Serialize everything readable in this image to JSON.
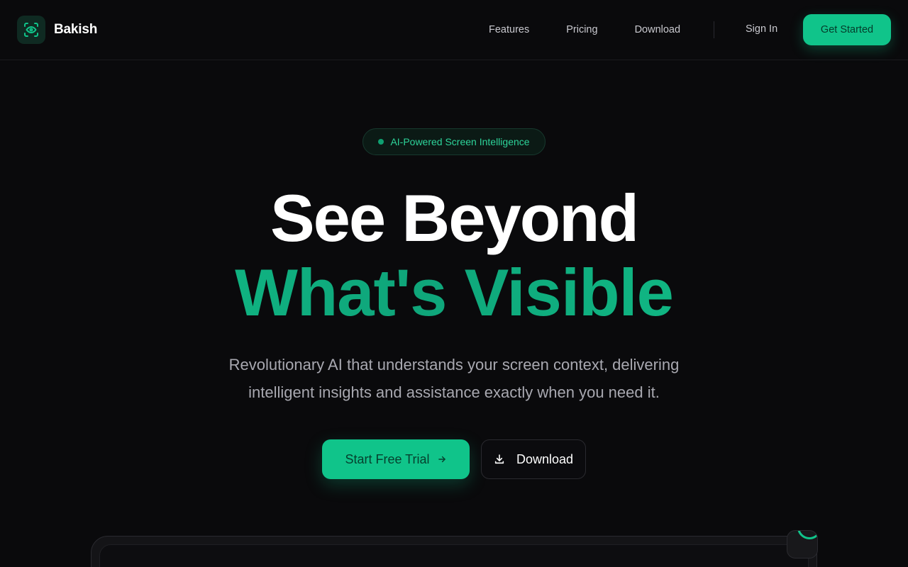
{
  "brand": {
    "name": "Bakish",
    "logo_icon": "eye-scan-icon"
  },
  "nav": {
    "links": [
      "Features",
      "Pricing",
      "Download"
    ],
    "sign_in": "Sign In",
    "cta": "Get Started"
  },
  "hero": {
    "badge": "AI-Powered Screen Intelligence",
    "headline_line1": "See Beyond",
    "headline_line2": "What's Visible",
    "subtitle": "Revolutionary AI that understands your screen context, delivering intelligent insights and assistance exactly when you need it.",
    "primary_button": "Start Free Trial",
    "secondary_button": "Download"
  },
  "colors": {
    "accent": "#10c48a",
    "background": "#0a0a0c",
    "text_muted": "#a8a8b0"
  }
}
